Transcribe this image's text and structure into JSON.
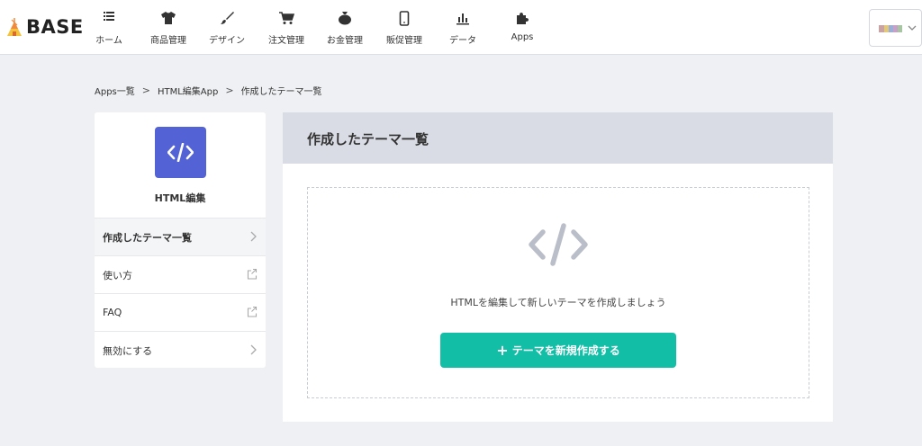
{
  "header": {
    "logo_text": "BASE",
    "nav": [
      {
        "label": "ホーム",
        "icon": "home-list-icon"
      },
      {
        "label": "商品管理",
        "icon": "shirt-icon"
      },
      {
        "label": "デザイン",
        "icon": "paintbrush-icon"
      },
      {
        "label": "注文管理",
        "icon": "cart-icon"
      },
      {
        "label": "お金管理",
        "icon": "money-bag-icon"
      },
      {
        "label": "販促管理",
        "icon": "smartphone-icon"
      },
      {
        "label": "データ",
        "icon": "bar-chart-icon"
      },
      {
        "label": "Apps",
        "icon": "puzzle-icon"
      }
    ]
  },
  "breadcrumb": {
    "items": [
      "Apps一覧",
      "HTML編集App",
      "作成したテーマ一覧"
    ],
    "separator": ">"
  },
  "sidebar": {
    "app_name": "HTML編集",
    "items": [
      {
        "label": "作成したテーマ一覧",
        "icon": "chevron-right-icon",
        "active": true
      },
      {
        "label": "使い方",
        "icon": "external-link-icon"
      },
      {
        "label": "FAQ",
        "icon": "external-link-icon"
      },
      {
        "label": "無効にする",
        "icon": "chevron-right-icon"
      }
    ]
  },
  "main": {
    "title": "作成したテーマ一覧",
    "empty_message": "HTMLを編集して新しいテーマを作成しましょう",
    "create_button_label": "テーマを新規作成する",
    "create_button_prefix": "+"
  },
  "colors": {
    "accent": "#13bea7",
    "app_icon_bg": "#5362d5",
    "header_panel_bg": "#d9dce4",
    "page_bg": "#eff0f3"
  }
}
